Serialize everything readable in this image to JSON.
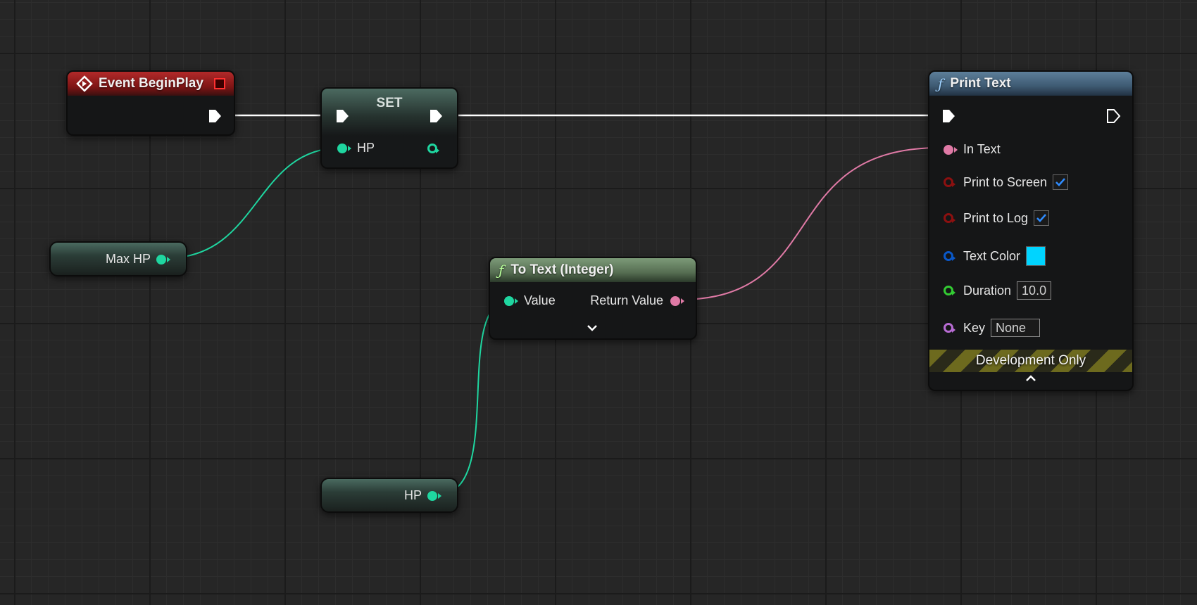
{
  "nodes": {
    "event_begin_play": {
      "title": "Event BeginPlay"
    },
    "set_node": {
      "title": "SET",
      "input_label": "HP"
    },
    "max_hp": {
      "label": "Max HP"
    },
    "hp_getter": {
      "label": "HP"
    },
    "to_text": {
      "icon": "function-icon",
      "title": "To Text (Integer)",
      "input_label": "Value",
      "output_label": "Return Value"
    },
    "print_text": {
      "icon": "function-icon",
      "title": "Print Text",
      "in_text_label": "In Text",
      "print_to_screen_label": "Print to Screen",
      "print_to_screen_checked": true,
      "print_to_log_label": "Print to Log",
      "print_to_log_checked": true,
      "text_color_label": "Text Color",
      "text_color_value": "#00d4ff",
      "duration_label": "Duration",
      "duration_value": "10.0",
      "key_label": "Key",
      "key_value": "None",
      "dev_only_label": "Development Only"
    }
  },
  "colors": {
    "exec_wire": "#ffffff",
    "int_pin": "#1fd6a0",
    "text_pin": "#e07aa6",
    "bool_pin": "#8c1010",
    "color_pin": "#0a58c8",
    "float_pin": "#33cc33",
    "name_pin": "#b86cd4"
  }
}
